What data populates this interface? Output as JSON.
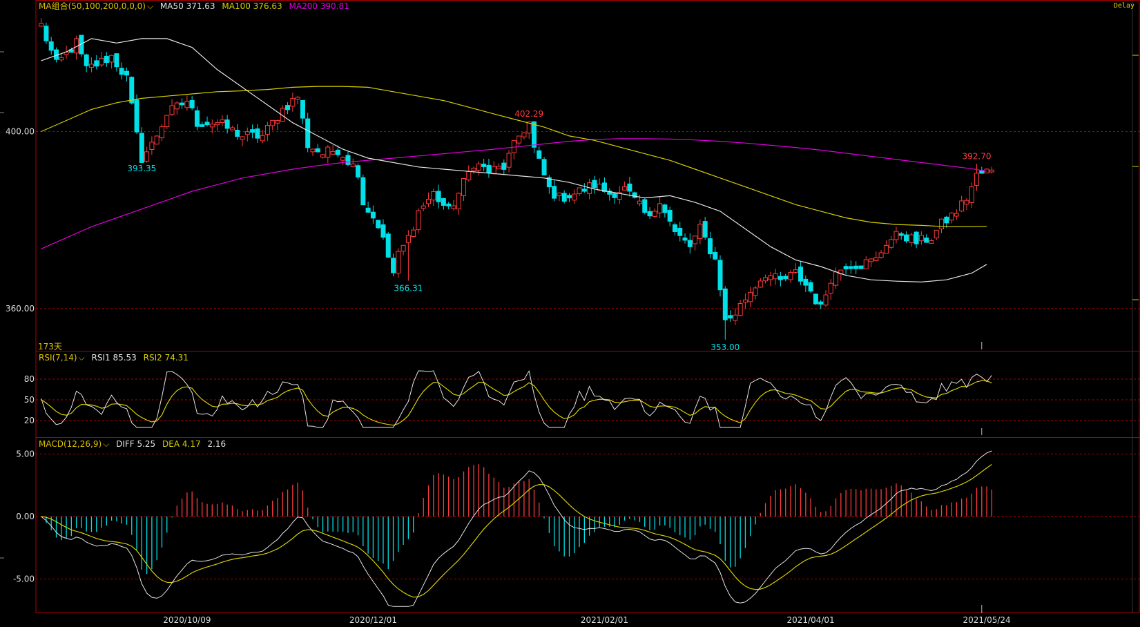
{
  "header": {
    "price_panel": {
      "indicator": "MA组合(50,100,200,0,0,0)",
      "ma50": "MA50 371.63",
      "ma100": "MA100 376.63",
      "ma200": "MA200 390.81"
    },
    "rsi_panel": {
      "indicator": "RSI(7,14)",
      "rsi1": "RSI1 85.53",
      "rsi2": "RSI2 74.31"
    },
    "macd_panel": {
      "indicator": "MACD(12,26,9)",
      "diff": "DIFF 5.25",
      "dea": "DEA 4.17",
      "macd": "2.16"
    }
  },
  "delay_label": "Delay",
  "days_label": "173天",
  "colors": {
    "up": "#ff3b3b",
    "down": "#00e0e8",
    "ma50": "#e6e6e6",
    "ma100": "#d8d000",
    "ma200": "#e000e0",
    "frame": "#b00000",
    "grid": "#b00000",
    "axis_text": "#dddddd",
    "header_indicator": "#e0c000"
  },
  "chart_data": [
    {
      "type": "candlestick",
      "title": "",
      "y_ticks": [
        "400.00",
        "360.00"
      ],
      "y_tick_values": [
        400,
        360
      ],
      "ylim": [
        351,
        426
      ],
      "x_ticks": [
        "2020/10/09",
        "2020/12/01",
        "2021/02/01",
        "2021/04/01",
        "2021/05/24"
      ],
      "x_tick_positions": [
        29,
        66,
        112,
        153,
        188
      ],
      "xlim": [
        0,
        190
      ],
      "annotations": [
        {
          "text": "393.35",
          "bar": 20,
          "value": 393.35,
          "side": "low"
        },
        {
          "text": "366.31",
          "bar": 73,
          "value": 366.31,
          "side": "low"
        },
        {
          "text": "402.29",
          "bar": 97,
          "value": 402.29,
          "side": "high"
        },
        {
          "text": "353.00",
          "bar": 136,
          "value": 353.0,
          "side": "low"
        },
        {
          "text": "392.70",
          "bar": 186,
          "value": 392.7,
          "side": "high"
        }
      ],
      "anchors": [
        [
          0,
          424
        ],
        [
          3,
          415
        ],
        [
          7,
          420
        ],
        [
          9,
          414
        ],
        [
          14,
          417
        ],
        [
          17,
          412
        ],
        [
          19,
          399
        ],
        [
          20,
          394
        ],
        [
          22,
          397
        ],
        [
          25,
          404
        ],
        [
          29,
          407
        ],
        [
          31,
          402
        ],
        [
          35,
          402
        ],
        [
          40,
          399
        ],
        [
          44,
          399
        ],
        [
          48,
          405
        ],
        [
          51,
          408
        ],
        [
          53,
          397
        ],
        [
          56,
          395
        ],
        [
          59,
          396
        ],
        [
          63,
          391
        ],
        [
          64,
          384
        ],
        [
          67,
          379
        ],
        [
          70,
          368
        ],
        [
          71,
          372
        ],
        [
          73,
          376
        ],
        [
          75,
          382
        ],
        [
          78,
          386
        ],
        [
          81,
          382
        ],
        [
          83,
          386
        ],
        [
          86,
          393
        ],
        [
          89,
          391
        ],
        [
          92,
          392
        ],
        [
          95,
          399
        ],
        [
          97,
          402
        ],
        [
          98,
          396
        ],
        [
          101,
          387
        ],
        [
          103,
          385
        ],
        [
          106,
          386
        ],
        [
          110,
          388
        ],
        [
          113,
          386
        ],
        [
          116,
          387
        ],
        [
          119,
          383
        ],
        [
          121,
          380
        ],
        [
          123,
          385
        ],
        [
          126,
          377
        ],
        [
          129,
          374
        ],
        [
          131,
          378
        ],
        [
          134,
          371
        ],
        [
          135,
          365
        ],
        [
          136,
          357
        ],
        [
          138,
          359
        ],
        [
          141,
          364
        ],
        [
          144,
          368
        ],
        [
          147,
          366
        ],
        [
          150,
          368
        ],
        [
          153,
          364
        ],
        [
          155,
          360
        ],
        [
          157,
          367
        ],
        [
          160,
          370
        ],
        [
          163,
          370
        ],
        [
          166,
          371
        ],
        [
          168,
          375
        ],
        [
          171,
          377
        ],
        [
          174,
          375
        ],
        [
          177,
          376
        ],
        [
          179,
          379
        ],
        [
          182,
          382
        ],
        [
          184,
          385
        ],
        [
          186,
          390
        ],
        [
          188,
          391
        ]
      ],
      "ma50": [
        [
          0,
          416
        ],
        [
          5,
          418
        ],
        [
          10,
          421
        ],
        [
          15,
          420
        ],
        [
          20,
          421
        ],
        [
          25,
          421
        ],
        [
          30,
          419
        ],
        [
          35,
          414
        ],
        [
          40,
          410
        ],
        [
          45,
          406
        ],
        [
          50,
          402
        ],
        [
          55,
          399
        ],
        [
          60,
          396
        ],
        [
          65,
          394
        ],
        [
          70,
          393
        ],
        [
          75,
          392
        ],
        [
          80,
          391.5
        ],
        [
          85,
          391
        ],
        [
          90,
          390.5
        ],
        [
          95,
          390
        ],
        [
          100,
          389.5
        ],
        [
          105,
          388.5
        ],
        [
          110,
          387
        ],
        [
          115,
          386
        ],
        [
          120,
          385
        ],
        [
          125,
          385.5
        ],
        [
          130,
          384
        ],
        [
          135,
          382
        ],
        [
          140,
          378
        ],
        [
          145,
          374
        ],
        [
          150,
          371
        ],
        [
          155,
          369.5
        ],
        [
          160,
          367.5
        ],
        [
          165,
          366.5
        ],
        [
          170,
          366.2
        ],
        [
          175,
          366
        ],
        [
          180,
          366.5
        ],
        [
          185,
          368
        ],
        [
          188,
          370
        ]
      ],
      "ma100": [
        [
          0,
          400
        ],
        [
          5,
          402.5
        ],
        [
          10,
          405
        ],
        [
          15,
          406.5
        ],
        [
          20,
          407.5
        ],
        [
          25,
          408
        ],
        [
          30,
          408.5
        ],
        [
          35,
          409
        ],
        [
          40,
          409.2
        ],
        [
          45,
          409.5
        ],
        [
          50,
          410
        ],
        [
          55,
          410.2
        ],
        [
          60,
          410.2
        ],
        [
          65,
          410
        ],
        [
          70,
          409
        ],
        [
          75,
          408
        ],
        [
          80,
          407
        ],
        [
          85,
          405.5
        ],
        [
          90,
          404
        ],
        [
          95,
          402.5
        ],
        [
          100,
          401
        ],
        [
          105,
          399
        ],
        [
          110,
          398
        ],
        [
          115,
          396.5
        ],
        [
          120,
          395
        ],
        [
          125,
          393.5
        ],
        [
          130,
          391.5
        ],
        [
          135,
          389.5
        ],
        [
          140,
          387.5
        ],
        [
          145,
          385.5
        ],
        [
          150,
          383.5
        ],
        [
          155,
          382
        ],
        [
          160,
          380.5
        ],
        [
          165,
          379.5
        ],
        [
          170,
          379
        ],
        [
          175,
          378.8
        ],
        [
          180,
          378.5
        ],
        [
          185,
          378.5
        ],
        [
          188,
          378.6
        ]
      ],
      "ma200": [
        [
          0,
          373.5
        ],
        [
          5,
          376
        ],
        [
          10,
          378.5
        ],
        [
          15,
          380.5
        ],
        [
          20,
          382.5
        ],
        [
          25,
          384.5
        ],
        [
          30,
          386.5
        ],
        [
          35,
          388
        ],
        [
          40,
          389.5
        ],
        [
          45,
          390.5
        ],
        [
          50,
          391.5
        ],
        [
          55,
          392.3
        ],
        [
          60,
          393
        ],
        [
          65,
          393.5
        ],
        [
          70,
          394
        ],
        [
          75,
          394.5
        ],
        [
          80,
          395
        ],
        [
          85,
          395.5
        ],
        [
          90,
          396
        ],
        [
          95,
          396.6
        ],
        [
          100,
          397.2
        ],
        [
          105,
          397.8
        ],
        [
          110,
          398.2
        ],
        [
          115,
          398.4
        ],
        [
          120,
          398.4
        ],
        [
          125,
          398.3
        ],
        [
          130,
          398.1
        ],
        [
          135,
          397.8
        ],
        [
          140,
          397.4
        ],
        [
          145,
          396.9
        ],
        [
          150,
          396.4
        ],
        [
          155,
          395.8
        ],
        [
          160,
          395.1
        ],
        [
          165,
          394.4
        ],
        [
          170,
          393.7
        ],
        [
          175,
          393
        ],
        [
          180,
          392.3
        ],
        [
          185,
          391.6
        ],
        [
          188,
          391
        ]
      ],
      "last": {
        "ma50": 371.63,
        "ma100": 376.63,
        "ma200": 390.81
      }
    },
    {
      "type": "line",
      "title": "",
      "y_ticks": [
        "80",
        "50",
        "20"
      ],
      "y_tick_values": [
        80,
        50,
        20
      ],
      "ylim": [
        0,
        100
      ],
      "series": [
        {
          "name": "RSI1",
          "last": 85.53
        },
        {
          "name": "RSI2",
          "last": 74.31
        }
      ]
    },
    {
      "type": "bar",
      "title": "",
      "y_ticks": [
        "5.00",
        "0.00",
        "-5.00"
      ],
      "y_tick_values": [
        5,
        0,
        -5
      ],
      "ylim": [
        -7.5,
        6.2
      ],
      "series": [
        {
          "name": "DIFF",
          "last": 5.25
        },
        {
          "name": "DEA",
          "last": 4.17
        },
        {
          "name": "MACD",
          "last": 2.16
        }
      ]
    }
  ]
}
